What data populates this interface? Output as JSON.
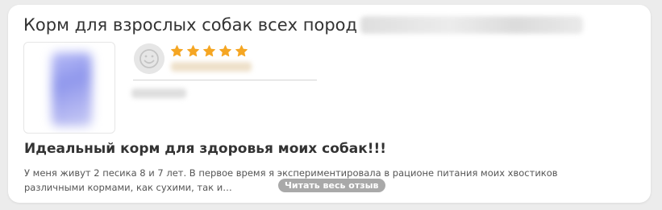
{
  "product": {
    "title": "Корм для взрослых собак всех пород",
    "image_icon": "dog-food-pack-image"
  },
  "review": {
    "author_avatar_icon": "smiley-face-icon",
    "rating": 5,
    "rating_max": 5,
    "star_color": "#f5a623",
    "title": "Идеальный корм для здоровья моих собак!!!",
    "excerpt": "У меня живут 2 песика 8 и 7 лет. В первое время я экспериментировала в рационе питания моих хвостиков различными кормами, как сухими, так и…",
    "read_more_label": "Читать весь отзыв"
  }
}
